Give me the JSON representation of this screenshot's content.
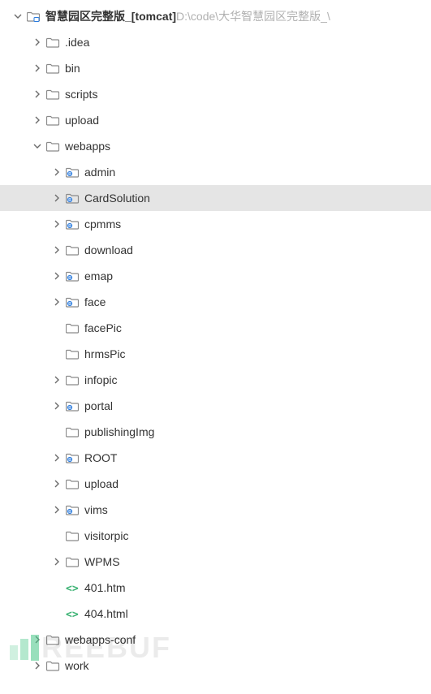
{
  "root": {
    "name": "智慧园区完整版_",
    "tag": "[tomcat]",
    "path": "D:\\code\\大华智慧园区完整版_\\"
  },
  "watermark": "REEBUF",
  "tree": [
    {
      "name": "智慧园区完整版_",
      "type": "root",
      "level": 0,
      "exp": "open",
      "selected": false
    },
    {
      "name": ".idea",
      "type": "folder",
      "level": 1,
      "exp": "closed",
      "selected": false
    },
    {
      "name": "bin",
      "type": "folder",
      "level": 1,
      "exp": "closed",
      "selected": false
    },
    {
      "name": "scripts",
      "type": "folder",
      "level": 1,
      "exp": "closed",
      "selected": false
    },
    {
      "name": "upload",
      "type": "folder",
      "level": 1,
      "exp": "closed",
      "selected": false
    },
    {
      "name": "webapps",
      "type": "folder",
      "level": 1,
      "exp": "open",
      "selected": false
    },
    {
      "name": "admin",
      "type": "webfolder",
      "level": 2,
      "exp": "closed",
      "selected": false
    },
    {
      "name": "CardSolution",
      "type": "webfolder",
      "level": 2,
      "exp": "closed",
      "selected": true
    },
    {
      "name": "cpmms",
      "type": "webfolder",
      "level": 2,
      "exp": "closed",
      "selected": false
    },
    {
      "name": "download",
      "type": "folder",
      "level": 2,
      "exp": "closed",
      "selected": false
    },
    {
      "name": "emap",
      "type": "webfolder",
      "level": 2,
      "exp": "closed",
      "selected": false
    },
    {
      "name": "face",
      "type": "webfolder",
      "level": 2,
      "exp": "closed",
      "selected": false
    },
    {
      "name": "facePic",
      "type": "folder",
      "level": 2,
      "exp": "none",
      "selected": false
    },
    {
      "name": "hrmsPic",
      "type": "folder",
      "level": 2,
      "exp": "none",
      "selected": false
    },
    {
      "name": "infopic",
      "type": "folder",
      "level": 2,
      "exp": "closed",
      "selected": false
    },
    {
      "name": "portal",
      "type": "webfolder",
      "level": 2,
      "exp": "closed",
      "selected": false
    },
    {
      "name": "publishingImg",
      "type": "folder",
      "level": 2,
      "exp": "none",
      "selected": false
    },
    {
      "name": "ROOT",
      "type": "webfolder",
      "level": 2,
      "exp": "closed",
      "selected": false
    },
    {
      "name": "upload",
      "type": "folder",
      "level": 2,
      "exp": "closed",
      "selected": false
    },
    {
      "name": "vims",
      "type": "webfolder",
      "level": 2,
      "exp": "closed",
      "selected": false
    },
    {
      "name": "visitorpic",
      "type": "folder",
      "level": 2,
      "exp": "none",
      "selected": false
    },
    {
      "name": "WPMS",
      "type": "folder",
      "level": 2,
      "exp": "closed",
      "selected": false
    },
    {
      "name": "401.htm",
      "type": "html",
      "level": 2,
      "exp": "none",
      "selected": false
    },
    {
      "name": "404.html",
      "type": "html",
      "level": 2,
      "exp": "none",
      "selected": false
    },
    {
      "name": "webapps-conf",
      "type": "folder",
      "level": 1,
      "exp": "closed",
      "selected": false
    },
    {
      "name": "work",
      "type": "folder",
      "level": 1,
      "exp": "closed",
      "selected": false
    }
  ]
}
